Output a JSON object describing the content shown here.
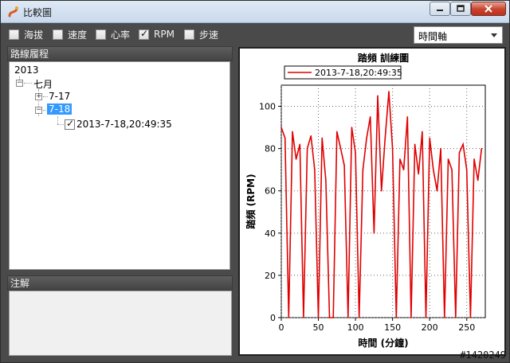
{
  "window": {
    "title": "比較圖",
    "controls": [
      "minimize-icon",
      "maximize-icon",
      "close-icon"
    ]
  },
  "toolbar": {
    "metrics": [
      {
        "label": "海拔",
        "checked": false
      },
      {
        "label": "速度",
        "checked": false
      },
      {
        "label": "心率",
        "checked": false
      },
      {
        "label": "RPM",
        "checked": true
      },
      {
        "label": "步速",
        "checked": false
      }
    ],
    "axis_select": "時間軸"
  },
  "route_panel": {
    "header": "路線履程",
    "year": "2013",
    "month": "七月",
    "day1": "7-17",
    "day2": "7-18",
    "session": "2013-7-18,20:49:35"
  },
  "notes_panel": {
    "header": "注解"
  },
  "watermark": "#1420249",
  "chart_data": {
    "type": "line",
    "title": "踏頻 訓練圖",
    "xlabel": "時間 (分鐘)",
    "ylabel": "踏頻 (RPM)",
    "xlim": [
      0,
      275
    ],
    "ylim": [
      0,
      110
    ],
    "x_ticks": [
      0,
      50,
      100,
      150,
      200,
      250
    ],
    "y_ticks": [
      0,
      20,
      40,
      60,
      80,
      100
    ],
    "grid": true,
    "legend_position": "top",
    "color": "#e00000",
    "series": [
      {
        "name": "2013-7-18,20:49:35",
        "x": [
          0,
          5,
          10,
          15,
          20,
          25,
          30,
          35,
          40,
          45,
          50,
          55,
          60,
          65,
          70,
          75,
          80,
          85,
          90,
          95,
          100,
          105,
          110,
          115,
          120,
          125,
          130,
          135,
          140,
          145,
          150,
          155,
          160,
          165,
          170,
          175,
          180,
          185,
          190,
          195,
          200,
          205,
          210,
          215,
          220,
          225,
          230,
          235,
          240,
          245,
          250,
          255,
          260,
          265,
          270
        ],
        "y": [
          90,
          85,
          0,
          88,
          75,
          82,
          0,
          80,
          86,
          70,
          0,
          85,
          65,
          0,
          0,
          88,
          80,
          72,
          0,
          90,
          78,
          0,
          70,
          85,
          95,
          40,
          105,
          60,
          85,
          107,
          80,
          0,
          75,
          70,
          95,
          0,
          82,
          68,
          88,
          0,
          85,
          70,
          60,
          80,
          0,
          75,
          70,
          0,
          78,
          82,
          70,
          0,
          75,
          65,
          80
        ]
      }
    ]
  }
}
